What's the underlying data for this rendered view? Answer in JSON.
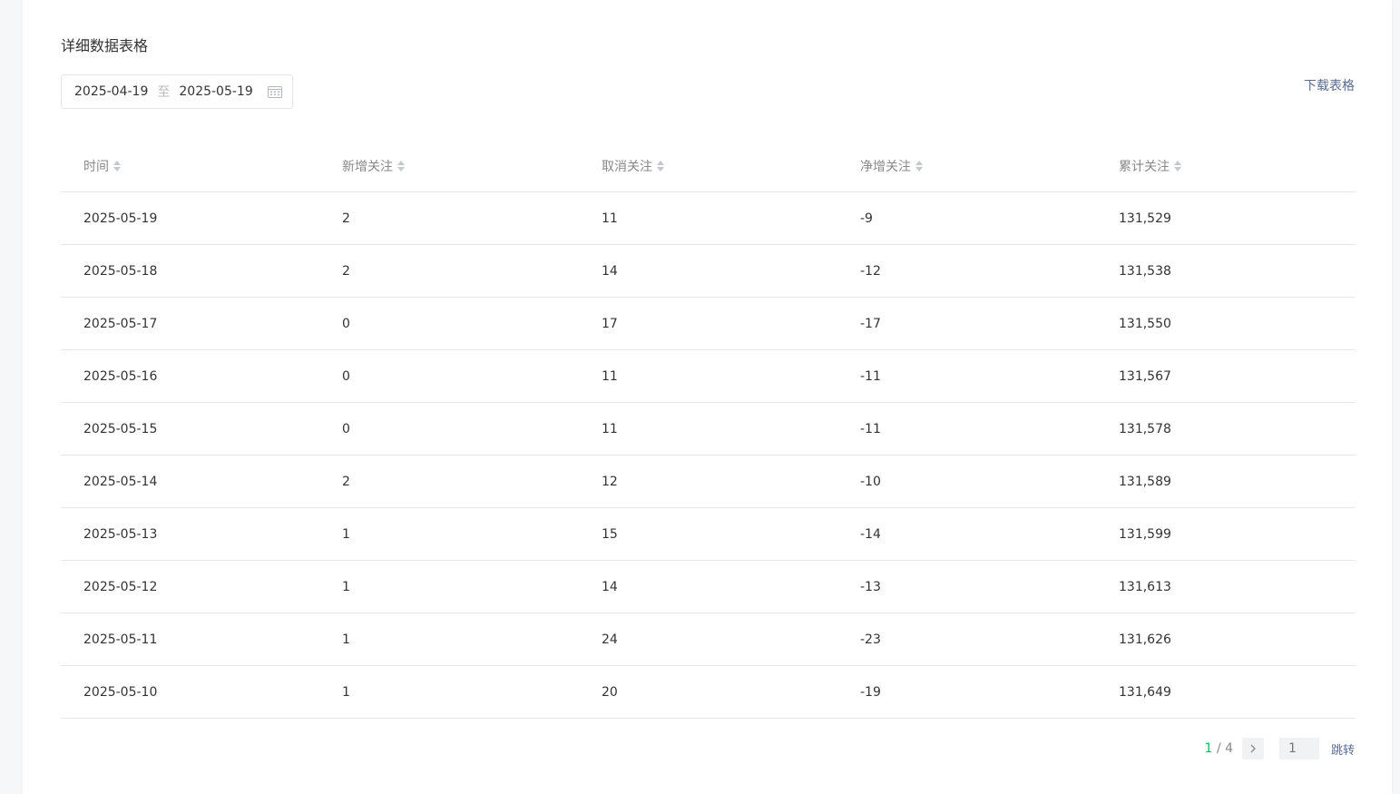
{
  "section": {
    "title": "详细数据表格",
    "download_label": "下载表格"
  },
  "date_range": {
    "start": "2025-04-19",
    "separator": "至",
    "end": "2025-05-19"
  },
  "table": {
    "columns": [
      "时间",
      "新增关注",
      "取消关注",
      "净增关注",
      "累计关注"
    ],
    "rows": [
      [
        "2025-05-19",
        "2",
        "11",
        "-9",
        "131,529"
      ],
      [
        "2025-05-18",
        "2",
        "14",
        "-12",
        "131,538"
      ],
      [
        "2025-05-17",
        "0",
        "17",
        "-17",
        "131,550"
      ],
      [
        "2025-05-16",
        "0",
        "11",
        "-11",
        "131,567"
      ],
      [
        "2025-05-15",
        "0",
        "11",
        "-11",
        "131,578"
      ],
      [
        "2025-05-14",
        "2",
        "12",
        "-10",
        "131,589"
      ],
      [
        "2025-05-13",
        "1",
        "15",
        "-14",
        "131,599"
      ],
      [
        "2025-05-12",
        "1",
        "14",
        "-13",
        "131,613"
      ],
      [
        "2025-05-11",
        "1",
        "24",
        "-23",
        "131,626"
      ],
      [
        "2025-05-10",
        "1",
        "20",
        "-19",
        "131,649"
      ]
    ]
  },
  "pagination": {
    "current": "1",
    "divider": " / ",
    "total": "4",
    "input_placeholder": "1",
    "jump_label": "跳转"
  },
  "colors": {
    "accent": "#07c160",
    "link": "#576b95"
  }
}
